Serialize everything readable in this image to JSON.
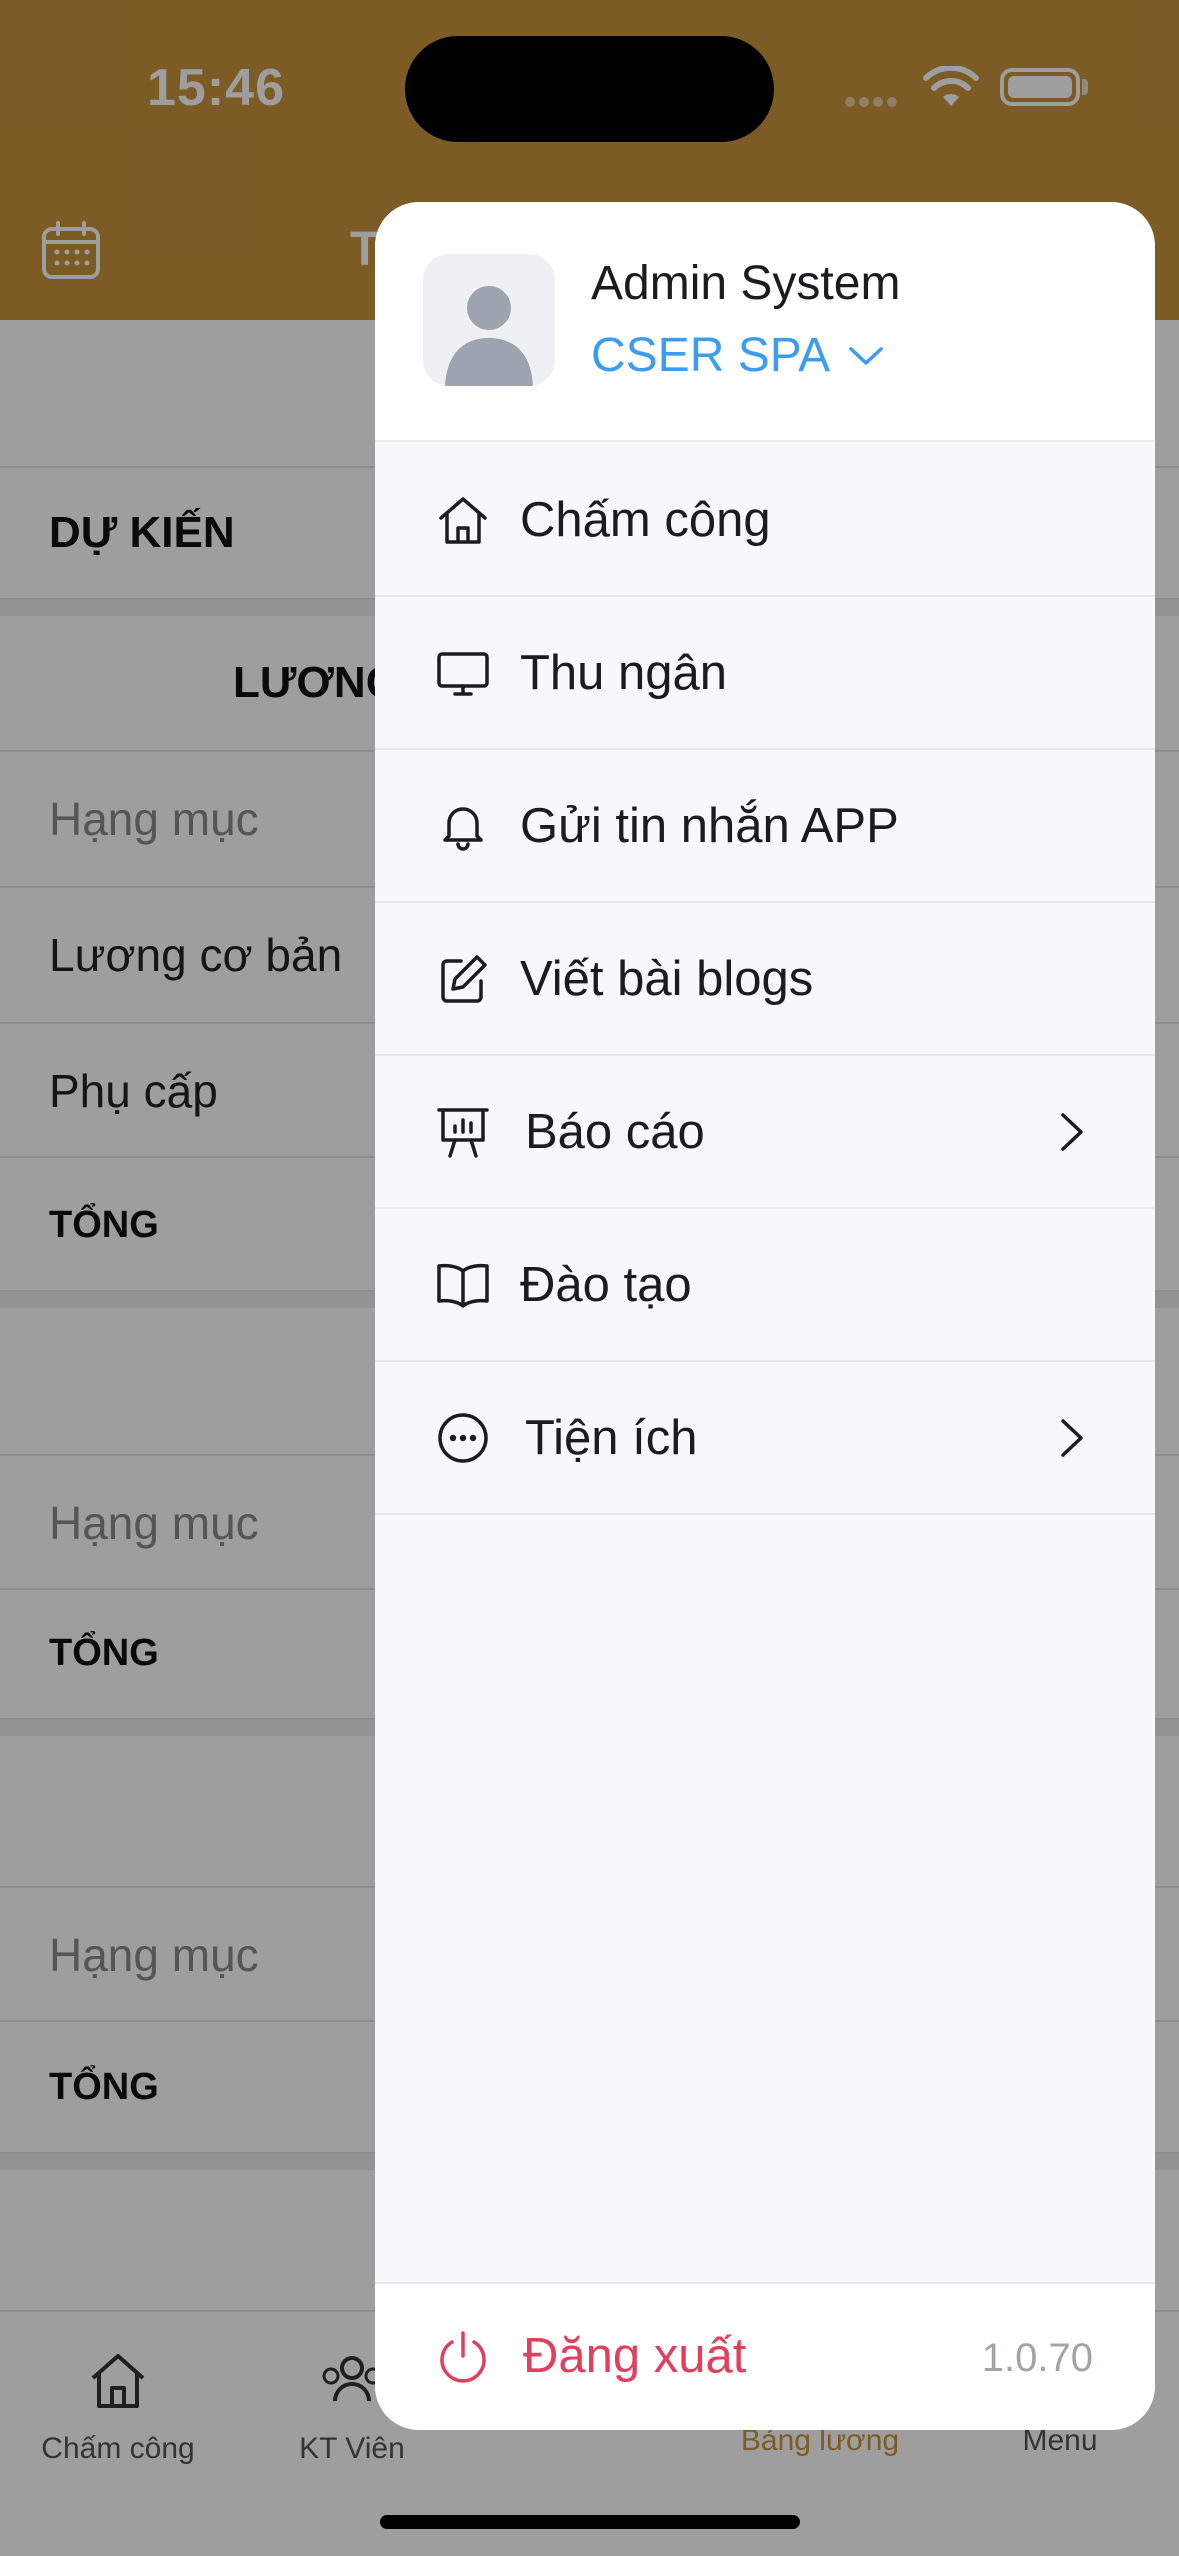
{
  "status_bar": {
    "time": "15:46"
  },
  "background": {
    "header_title_stub": "T",
    "section_title": "DỰ KIẾN",
    "block1_title": "LƯƠNG",
    "block1_rows": [
      "Hạng mục",
      "Lương cơ bản",
      "Phụ cấp"
    ],
    "block1_total": "TỔNG",
    "block2_rows": [
      "Hạng mục"
    ],
    "block2_total": "TỔNG",
    "block3_rows": [
      "Hạng mục"
    ],
    "block3_total": "TỔNG",
    "tabs": [
      {
        "label": "Chấm công",
        "icon": "home-icon"
      },
      {
        "label": "KT Viên",
        "icon": "users-icon"
      },
      {
        "label": "Bảng lương",
        "icon": "salary-icon"
      },
      {
        "label": "Menu",
        "icon": "menu-icon"
      }
    ]
  },
  "drawer": {
    "user_name": "Admin System",
    "organization": "CSER SPA",
    "menu": [
      {
        "label": "Chấm công",
        "icon": "home-icon",
        "has_submenu": false
      },
      {
        "label": "Thu ngân",
        "icon": "monitor-icon",
        "has_submenu": false
      },
      {
        "label": "Gửi tin nhắn APP",
        "icon": "bell-icon",
        "has_submenu": false
      },
      {
        "label": "Viết bài blogs",
        "icon": "edit-icon",
        "has_submenu": false
      },
      {
        "label": "Báo cáo",
        "icon": "presentation-chart-icon",
        "has_submenu": true
      },
      {
        "label": "Đào tạo",
        "icon": "book-icon",
        "has_submenu": false
      },
      {
        "label": "Tiện ích",
        "icon": "more-circle-icon",
        "has_submenu": true
      }
    ],
    "logout_label": "Đăng xuất",
    "version": "1.0.70"
  },
  "colors": {
    "header": "#c9933d",
    "accent_blue": "#3c9df0",
    "logout_red": "#e23f5f"
  }
}
